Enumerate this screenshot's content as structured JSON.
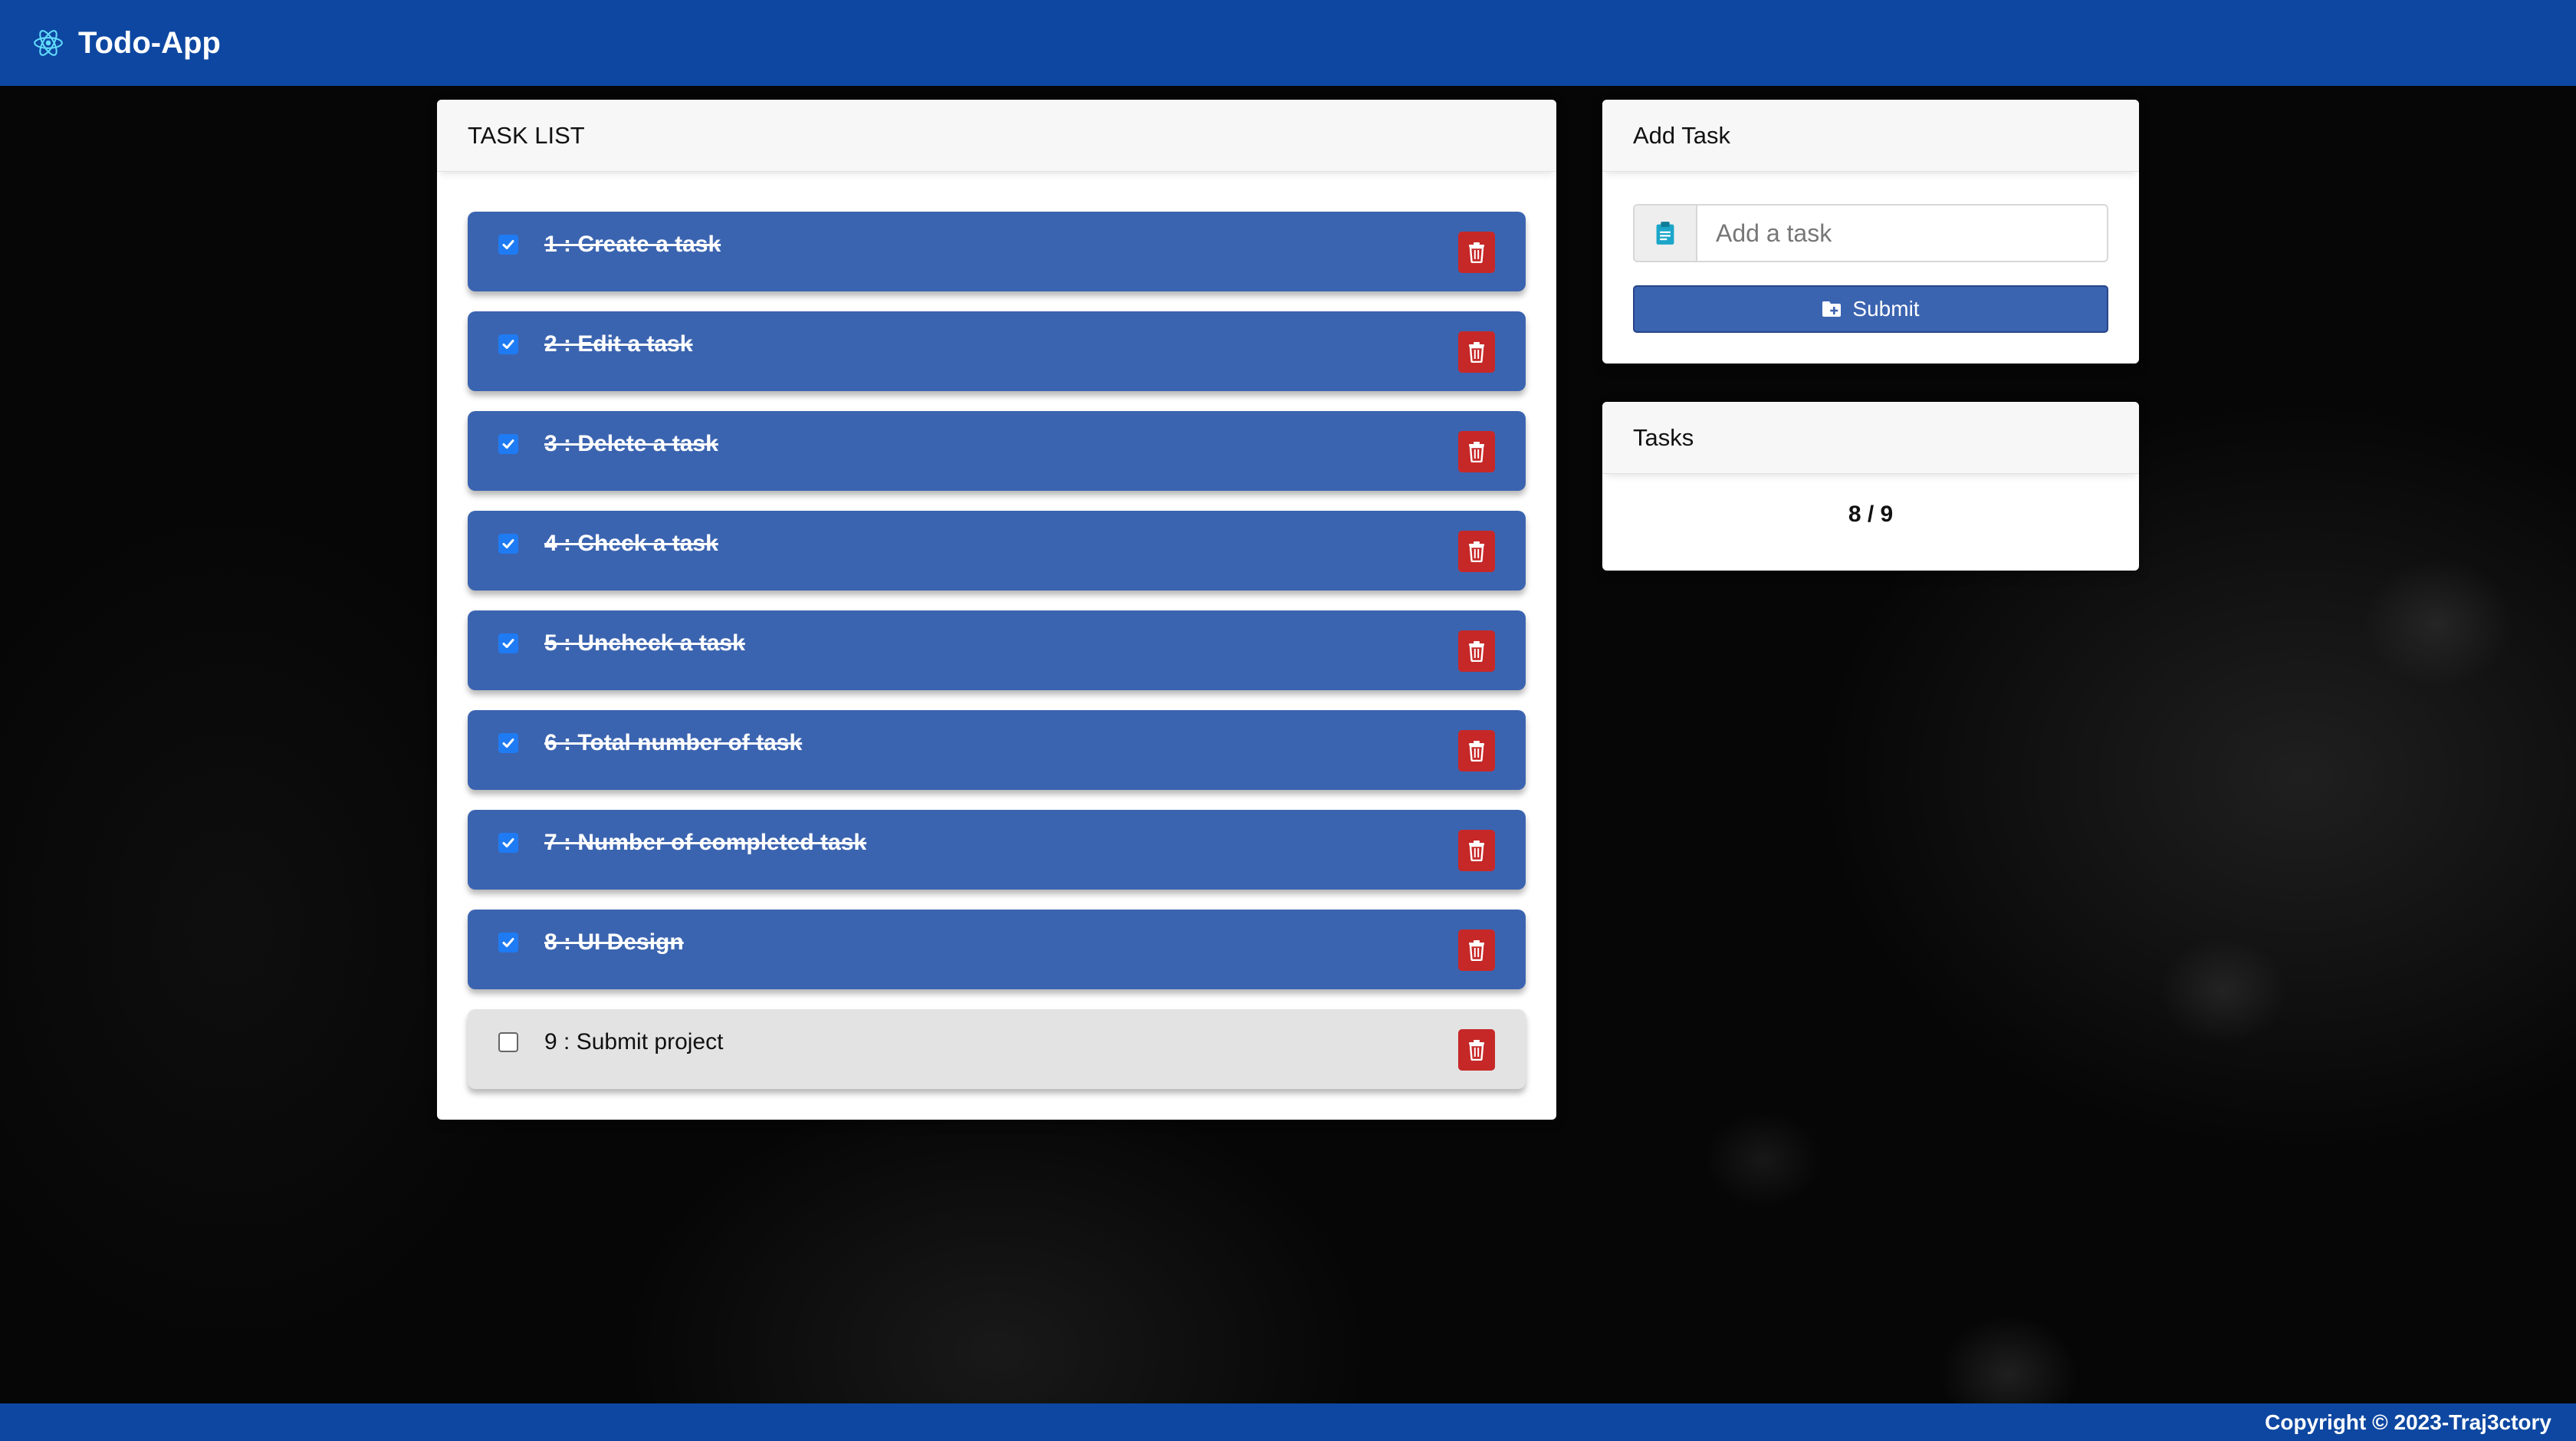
{
  "header": {
    "title": "Todo-App",
    "icon": "react-atom-icon"
  },
  "task_list": {
    "title": "TASK LIST",
    "items": [
      {
        "label": "1 : Create a task",
        "checked": true
      },
      {
        "label": "2 : Edit a task",
        "checked": true
      },
      {
        "label": "3 : Delete a task",
        "checked": true
      },
      {
        "label": "4 : Check a task",
        "checked": true
      },
      {
        "label": "5 : Uncheck a task",
        "checked": true
      },
      {
        "label": "6 : Total number of task",
        "checked": true
      },
      {
        "label": "7 : Number of completed task",
        "checked": true
      },
      {
        "label": "8 : UI Design",
        "checked": true
      },
      {
        "label": "9 : Submit project",
        "checked": false
      }
    ]
  },
  "add_task": {
    "title": "Add Task",
    "input_placeholder": "Add a task",
    "input_value": "",
    "submit_label": "Submit"
  },
  "tasks_count": {
    "title": "Tasks",
    "value": "8 / 9"
  },
  "footer": {
    "copyright": "Copyright © 2023-Traj3ctory"
  },
  "colors": {
    "navbar": "#0d47a1",
    "task_done_bg": "#3b64b0",
    "task_open_bg": "#e3e3e3",
    "delete_red": "#c62828",
    "checkbox_blue": "#1e7bf3"
  }
}
